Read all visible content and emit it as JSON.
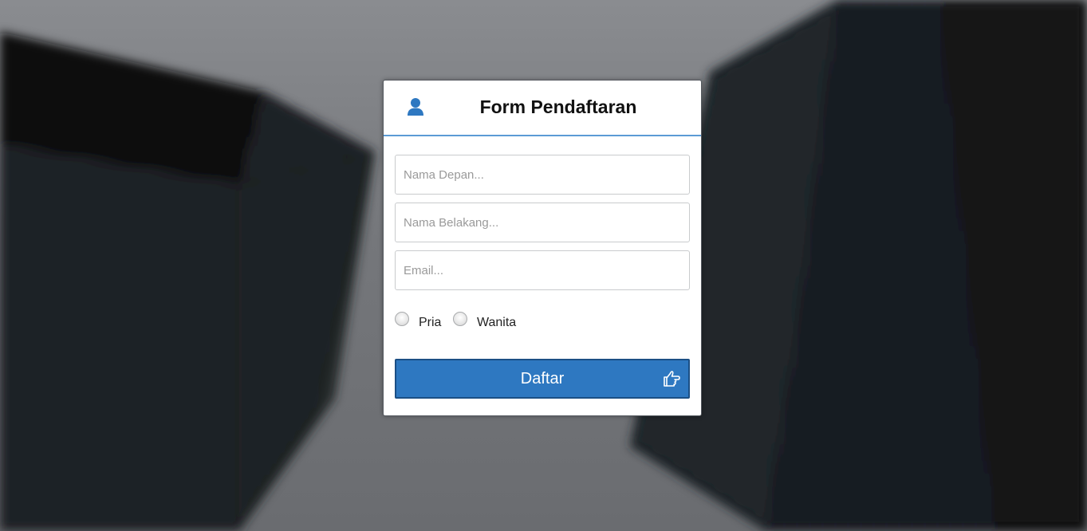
{
  "form": {
    "title": "Form Pendaftaran",
    "header_icon": "user-icon",
    "accent_color": "#5b9bd5",
    "fields": {
      "first_name": {
        "placeholder": "Nama Depan...",
        "value": ""
      },
      "last_name": {
        "placeholder": "Nama Belakang...",
        "value": ""
      },
      "email": {
        "placeholder": "Email...",
        "value": ""
      }
    },
    "gender": {
      "options": [
        "Pria",
        "Wanita"
      ],
      "selected": null
    },
    "submit": {
      "label": "Daftar",
      "icon": "hand-pointer-right-icon",
      "color": "#2e78c1"
    }
  }
}
